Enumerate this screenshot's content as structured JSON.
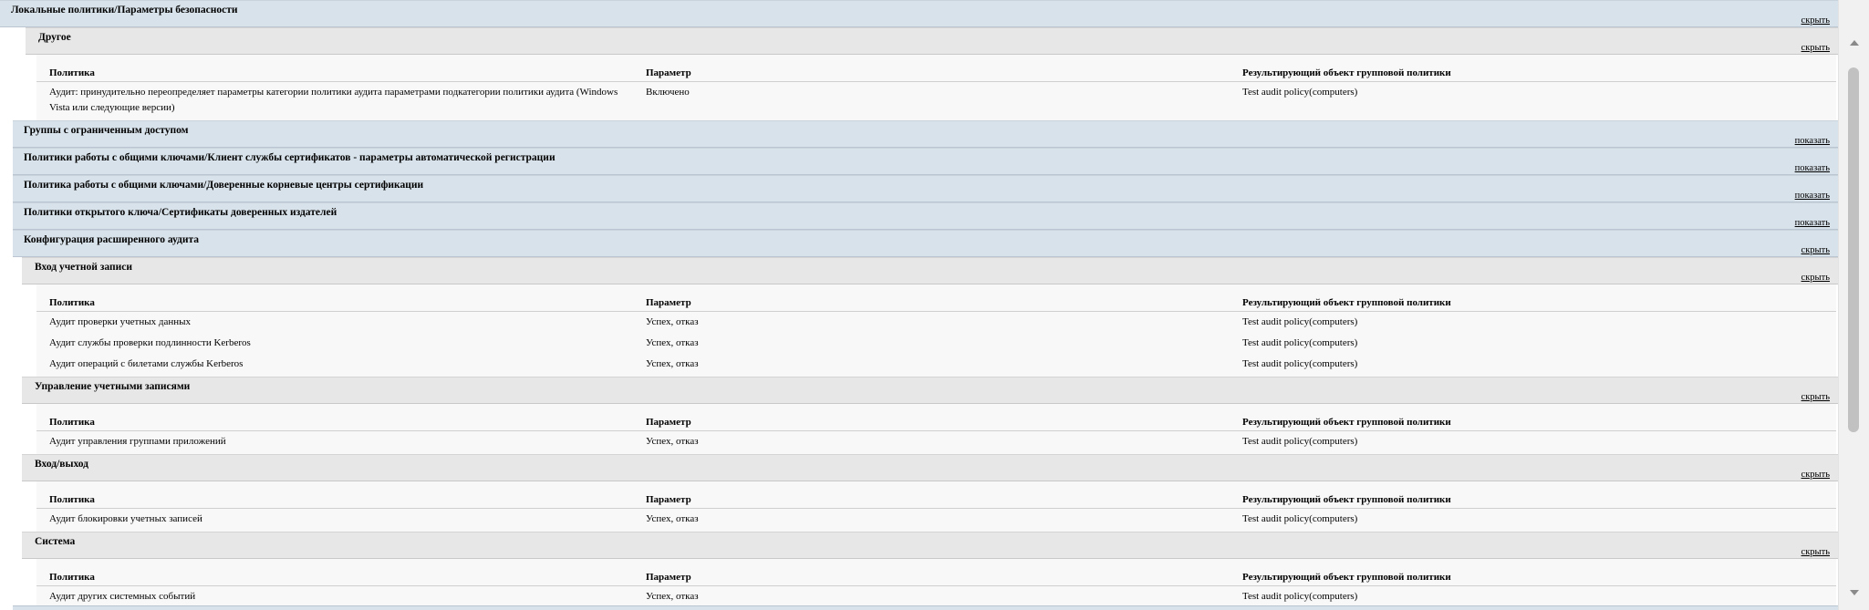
{
  "columns": {
    "policy": "Политика",
    "setting": "Параметр",
    "gpo": "Результирующий объект групповой политики"
  },
  "toggle": {
    "hide": "скрыть",
    "show": "показать"
  },
  "local_policies": {
    "title": "Локальные политики/Параметры безопасности",
    "other": {
      "title": "Другое",
      "rows": [
        {
          "policy": "Аудит: принудительно переопределяет параметры категории политики аудита параметрами подкатегории политики аудита (Windows Vista или следующие версии)",
          "setting": "Включено",
          "gpo": "Test audit policy(computers)"
        }
      ]
    }
  },
  "collapsed_sections": [
    "Группы с ограниченным доступом",
    "Политики работы с общими ключами/Клиент службы сертификатов - параметры автоматической регистрации",
    "Политика работы с общими ключами/Доверенные корневые центры сертификации",
    "Политики открытого ключа/Сертификаты доверенных издателей"
  ],
  "advanced_audit": {
    "title": "Конфигурация расширенного аудита",
    "groups": [
      {
        "title": "Вход учетной записи",
        "rows": [
          {
            "policy": "Аудит проверки учетных данных",
            "setting": "Успех, отказ",
            "gpo": "Test audit policy(computers)"
          },
          {
            "policy": "Аудит службы проверки подлинности Kerberos",
            "setting": "Успех, отказ",
            "gpo": "Test audit policy(computers)"
          },
          {
            "policy": "Аудит операций с билетами службы Kerberos",
            "setting": "Успех, отказ",
            "gpo": "Test audit policy(computers)"
          }
        ]
      },
      {
        "title": "Управление учетными записями",
        "rows": [
          {
            "policy": "Аудит управления группами приложений",
            "setting": "Успех, отказ",
            "gpo": "Test audit policy(computers)"
          }
        ]
      },
      {
        "title": "Вход/выход",
        "rows": [
          {
            "policy": "Аудит блокировки учетных записей",
            "setting": "Успех, отказ",
            "gpo": "Test audit policy(computers)"
          }
        ]
      },
      {
        "title": "Система",
        "rows": [
          {
            "policy": "Аудит других системных событий",
            "setting": "Успех, отказ",
            "gpo": "Test audit policy(computers)"
          }
        ]
      }
    ]
  }
}
